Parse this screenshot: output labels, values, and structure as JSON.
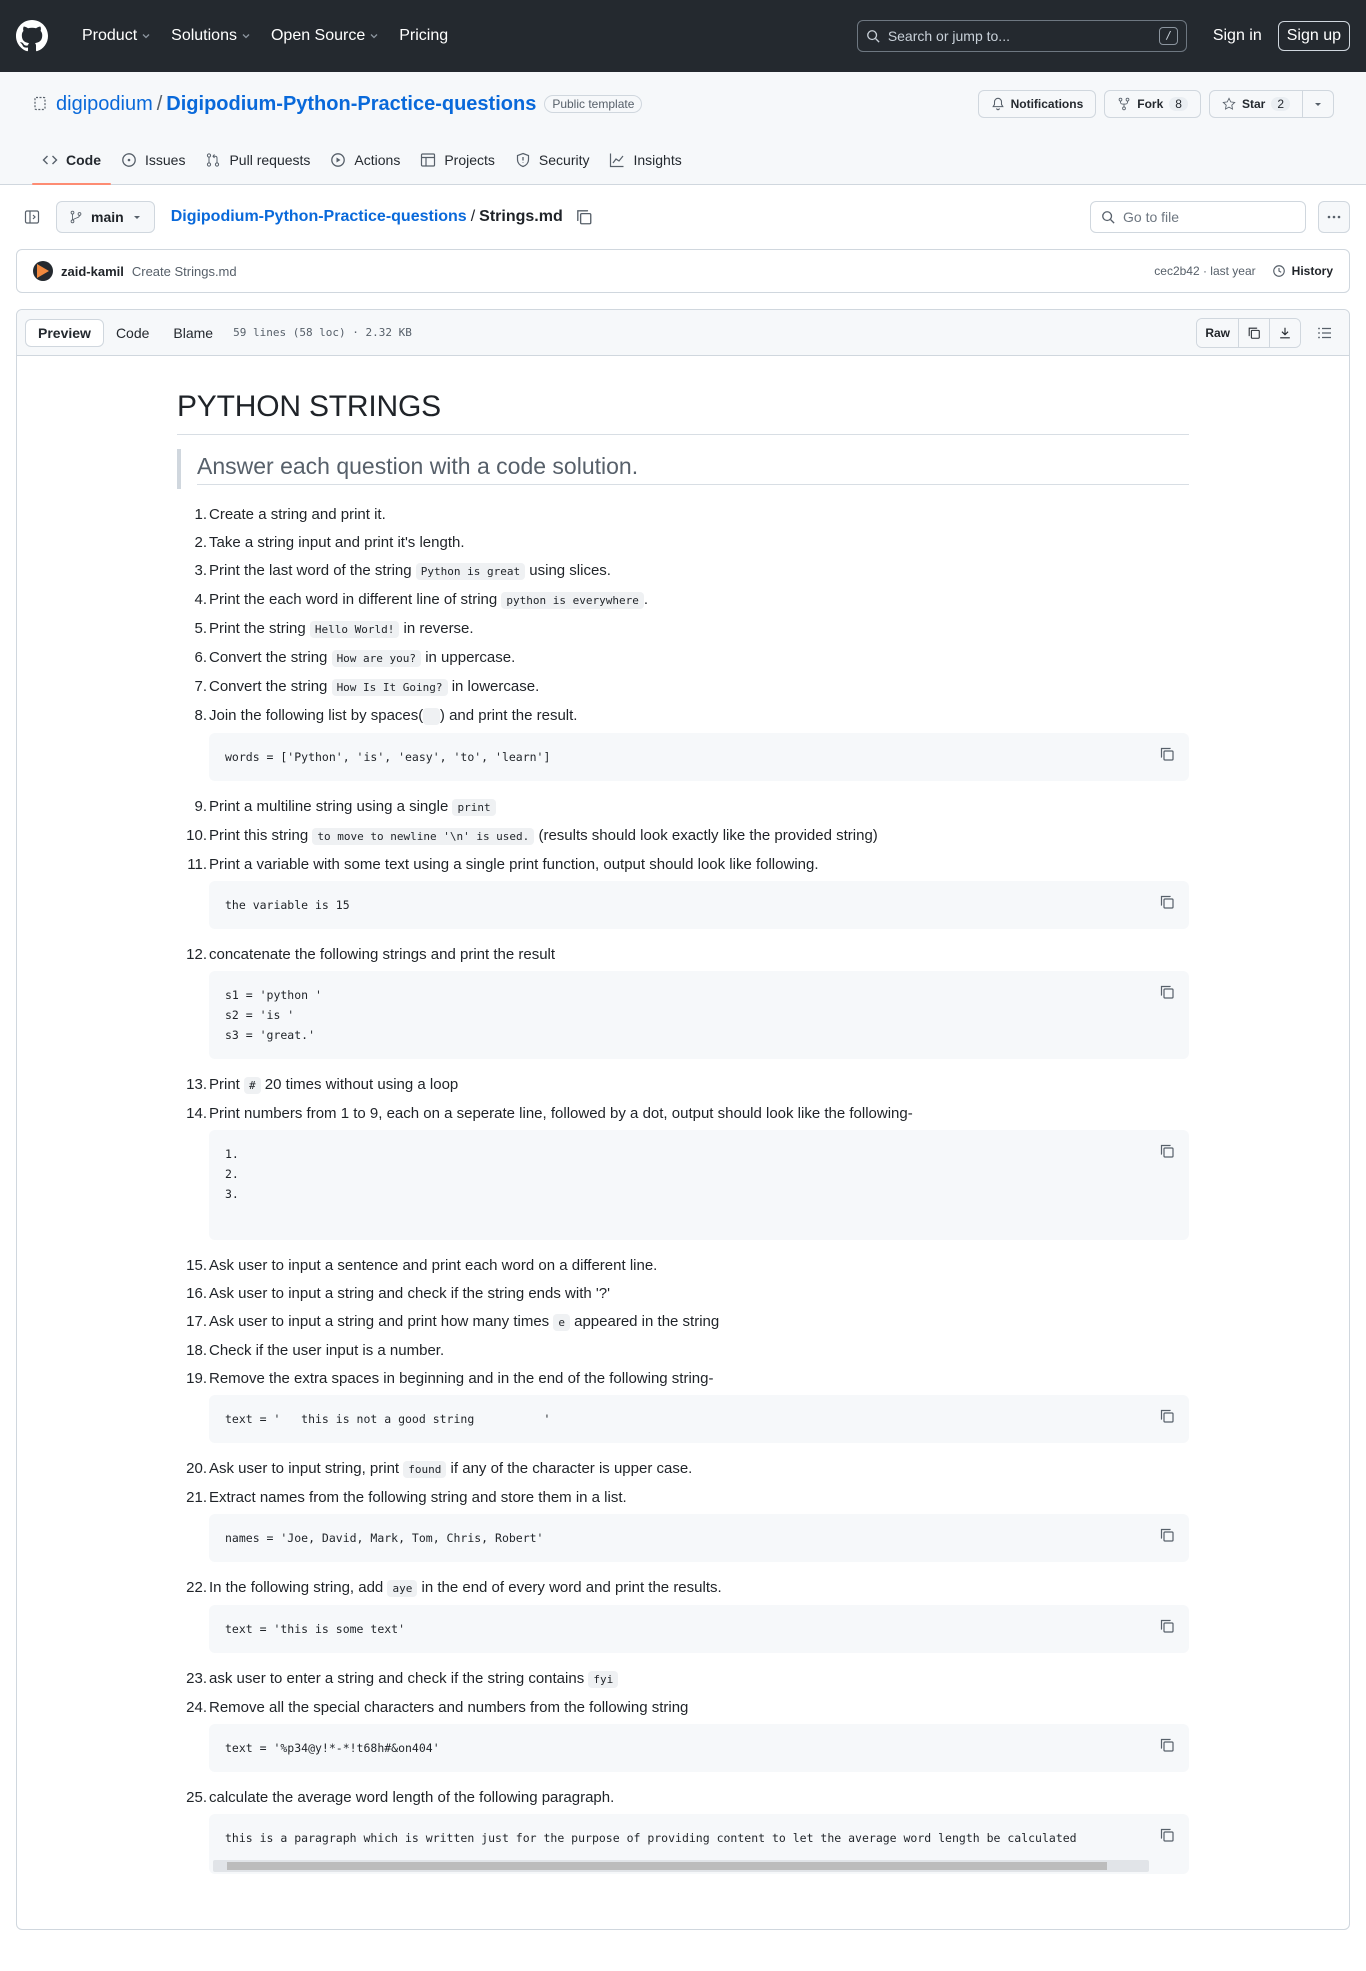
{
  "topbar": {
    "nav": [
      "Product",
      "Solutions",
      "Open Source",
      "Pricing"
    ],
    "search_placeholder": "Search or jump to...",
    "search_shortcut": "/",
    "signin": "Sign in",
    "signup": "Sign up"
  },
  "repo": {
    "owner": "digipodium",
    "separator": "/",
    "name": "Digipodium-Python-Practice-questions",
    "visibility": "Public template",
    "notifications": "Notifications",
    "fork_label": "Fork",
    "fork_count": "8",
    "star_label": "Star",
    "star_count": "2",
    "tabs": [
      "Code",
      "Issues",
      "Pull requests",
      "Actions",
      "Projects",
      "Security",
      "Insights"
    ]
  },
  "filenav": {
    "branch": "main",
    "repo_link": "Digipodium-Python-Practice-questions",
    "separator": "/",
    "file": "Strings.md",
    "goto_placeholder": "Go to file"
  },
  "commit": {
    "author": "zaid-kamil",
    "message": "Create Strings.md",
    "meta": "cec2b42 · last year",
    "history": "History"
  },
  "fileheader": {
    "views": [
      "Preview",
      "Code",
      "Blame"
    ],
    "info": "59 lines (58 loc) · 2.32 KB",
    "raw": "Raw"
  },
  "markdown": {
    "title": "PYTHON STRINGS",
    "quote": "Answer each question with a code solution.",
    "items": [
      {
        "n": "1.",
        "parts": [
          {
            "t": "Create a string and print it."
          }
        ]
      },
      {
        "n": "2.",
        "parts": [
          {
            "t": "Take a string input and print it's length."
          }
        ]
      },
      {
        "n": "3.",
        "parts": [
          {
            "t": "Print the last word of the string "
          },
          {
            "c": "Python is great"
          },
          {
            "t": " using slices."
          }
        ]
      },
      {
        "n": "4.",
        "parts": [
          {
            "t": "Print the each word in different line of string "
          },
          {
            "c": "python is everywhere"
          },
          {
            "t": "."
          }
        ]
      },
      {
        "n": "5.",
        "parts": [
          {
            "t": "Print the string "
          },
          {
            "c": "Hello World!"
          },
          {
            "t": " in reverse."
          }
        ]
      },
      {
        "n": "6.",
        "parts": [
          {
            "t": "Convert the string "
          },
          {
            "c": "How are you?"
          },
          {
            "t": " in uppercase."
          }
        ]
      },
      {
        "n": "7.",
        "parts": [
          {
            "t": "Convert the string "
          },
          {
            "c": "How Is It Going?"
          },
          {
            "t": " in lowercase."
          }
        ]
      },
      {
        "n": "8.",
        "parts": [
          {
            "t": "Join the following list by spaces("
          },
          {
            "c": " "
          },
          {
            "t": ") and print the result."
          }
        ],
        "code": "words = ['Python', 'is', 'easy', 'to', 'learn']"
      },
      {
        "n": "9.",
        "parts": [
          {
            "t": "Print a multiline string using a single "
          },
          {
            "c": "print"
          }
        ]
      },
      {
        "n": "10.",
        "parts": [
          {
            "t": "Print this string "
          },
          {
            "c": "to move to newline '\\n' is used."
          },
          {
            "t": " (results should look exactly like the provided string)"
          }
        ]
      },
      {
        "n": "11.",
        "parts": [
          {
            "t": "Print a variable with some text using a single print function, output should look like following."
          }
        ],
        "code": "the variable is 15"
      },
      {
        "n": "12.",
        "parts": [
          {
            "t": "concatenate the following strings and print the result"
          }
        ],
        "code": "s1 = 'python '\ns2 = 'is '\ns3 = 'great.'"
      },
      {
        "n": "13.",
        "parts": [
          {
            "t": "Print "
          },
          {
            "c": "#"
          },
          {
            "t": " 20 times without using a loop"
          }
        ]
      },
      {
        "n": "14.",
        "parts": [
          {
            "t": "Print numbers from 1 to 9, each on a seperate line, followed by a dot, output should look like the following-"
          }
        ],
        "code": "1.\n2.\n3.",
        "tall": true
      },
      {
        "n": "15.",
        "parts": [
          {
            "t": "Ask user to input a sentence and print each word on a different line."
          }
        ]
      },
      {
        "n": "16.",
        "parts": [
          {
            "t": "Ask user to input a string and check if the string ends with '?'"
          }
        ]
      },
      {
        "n": "17.",
        "parts": [
          {
            "t": "Ask user to input a string and print how many times "
          },
          {
            "c": "e"
          },
          {
            "t": " appeared in the string"
          }
        ]
      },
      {
        "n": "18.",
        "parts": [
          {
            "t": "Check if the user input is a number."
          }
        ]
      },
      {
        "n": "19.",
        "parts": [
          {
            "t": "Remove the extra spaces in beginning and in the end of the following string-"
          }
        ],
        "code": "text = '   this is not a good string          '"
      },
      {
        "n": "20.",
        "parts": [
          {
            "t": "Ask user to input string, print "
          },
          {
            "c": "found"
          },
          {
            "t": " if any of the character is upper case."
          }
        ]
      },
      {
        "n": "21.",
        "parts": [
          {
            "t": "Extract names from the following string and store them in a list."
          }
        ],
        "code": "names = 'Joe, David, Mark, Tom, Chris, Robert'"
      },
      {
        "n": "22.",
        "parts": [
          {
            "t": "In the following string, add "
          },
          {
            "c": "aye"
          },
          {
            "t": " in the end of every word and print the results."
          }
        ],
        "code": "text = 'this is some text'"
      },
      {
        "n": "23.",
        "parts": [
          {
            "t": "ask user to enter a string and check if the string contains "
          },
          {
            "c": "fyi"
          }
        ]
      },
      {
        "n": "24.",
        "parts": [
          {
            "t": "Remove all the special characters and numbers from the following string"
          }
        ],
        "code": "text = '%p34@y!*-*!t68h#&on404'"
      },
      {
        "n": "25.",
        "parts": [
          {
            "t": "calculate the average word length of the following paragraph."
          }
        ],
        "code": "this is a paragraph which is written just for the purpose of providing content to let the average word length be calculated",
        "scroll": true
      }
    ]
  }
}
